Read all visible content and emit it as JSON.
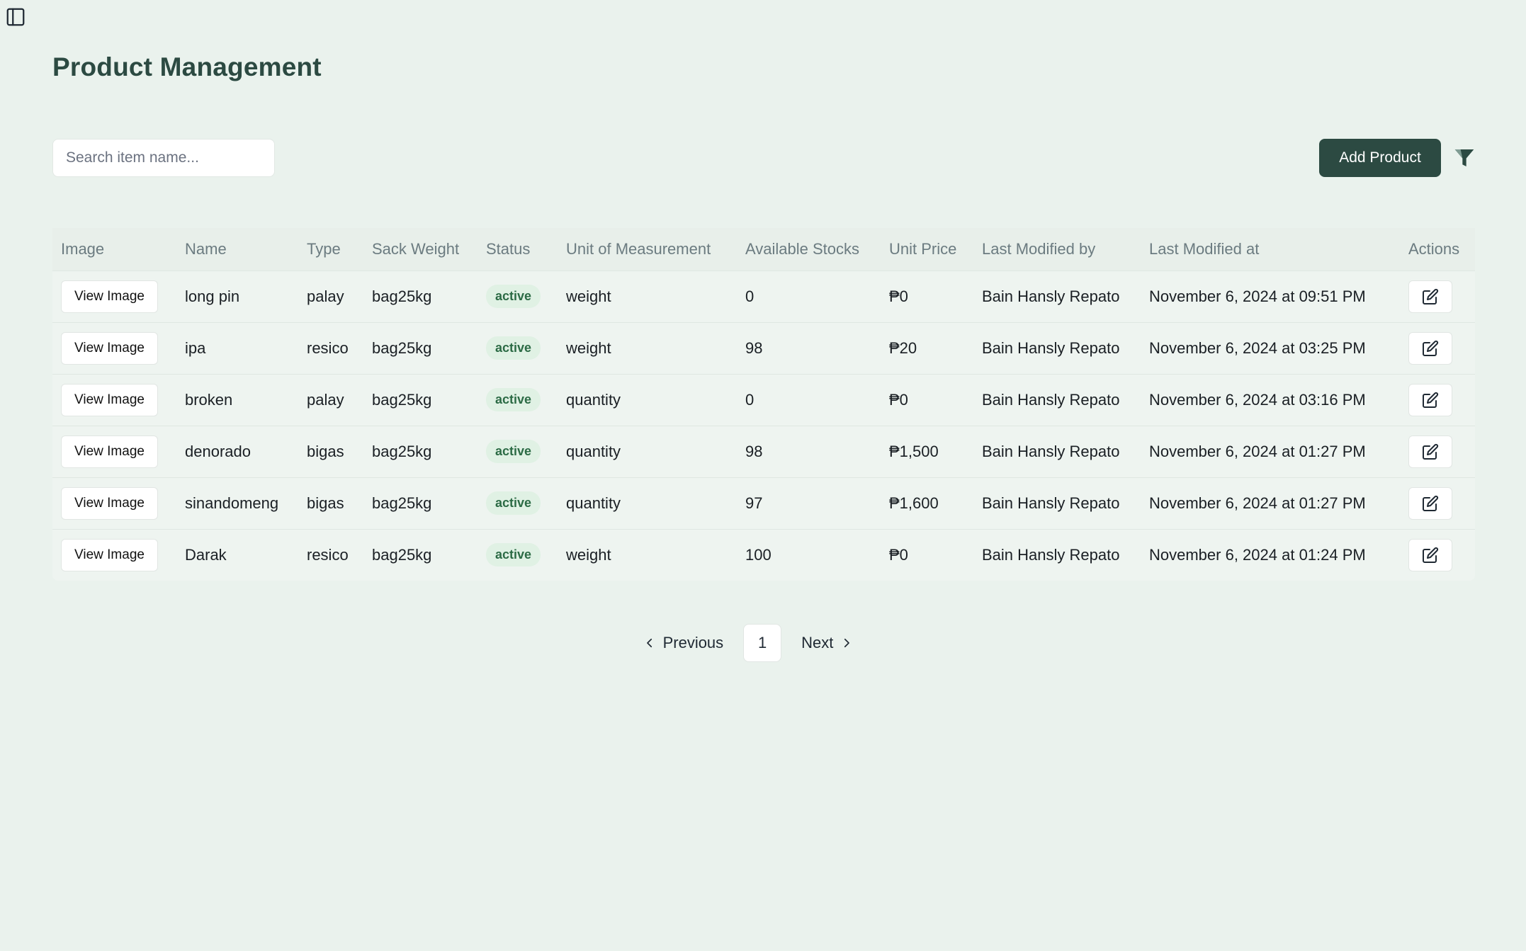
{
  "page": {
    "title": "Product Management"
  },
  "toolbar": {
    "search_placeholder": "Search item name...",
    "search_value": "",
    "add_label": "Add Product"
  },
  "colors": {
    "accent": "#2c4a42",
    "background": "#eaf2ed",
    "status_bg": "#e0f1e4",
    "status_text": "#2c6b45"
  },
  "icons": {
    "sidebar_toggle": "sidebar-toggle-icon",
    "filter": "filter-icon",
    "edit": "edit-icon",
    "prev": "chevron-left-icon",
    "next": "chevron-right-icon"
  },
  "table": {
    "headers": [
      "Image",
      "Name",
      "Type",
      "Sack Weight",
      "Status",
      "Unit of Measurement",
      "Available Stocks",
      "Unit Price",
      "Last Modified by",
      "Last Modified at",
      "Actions"
    ],
    "view_image_label": "View Image",
    "rows": [
      {
        "name": "long pin",
        "type": "palay",
        "sack_weight": "bag25kg",
        "status": "active",
        "unit": "weight",
        "stocks": "0",
        "price": "₱0",
        "modified_by": "Bain Hansly Repato",
        "modified_at": "November 6, 2024 at 09:51 PM"
      },
      {
        "name": "ipa",
        "type": "resico",
        "sack_weight": "bag25kg",
        "status": "active",
        "unit": "weight",
        "stocks": "98",
        "price": "₱20",
        "modified_by": "Bain Hansly Repato",
        "modified_at": "November 6, 2024 at 03:25 PM"
      },
      {
        "name": "broken",
        "type": "palay",
        "sack_weight": "bag25kg",
        "status": "active",
        "unit": "quantity",
        "stocks": "0",
        "price": "₱0",
        "modified_by": "Bain Hansly Repato",
        "modified_at": "November 6, 2024 at 03:16 PM"
      },
      {
        "name": "denorado",
        "type": "bigas",
        "sack_weight": "bag25kg",
        "status": "active",
        "unit": "quantity",
        "stocks": "98",
        "price": "₱1,500",
        "modified_by": "Bain Hansly Repato",
        "modified_at": "November 6, 2024 at 01:27 PM"
      },
      {
        "name": "sinandomeng",
        "type": "bigas",
        "sack_weight": "bag25kg",
        "status": "active",
        "unit": "quantity",
        "stocks": "97",
        "price": "₱1,600",
        "modified_by": "Bain Hansly Repato",
        "modified_at": "November 6, 2024 at 01:27 PM"
      },
      {
        "name": "Darak",
        "type": "resico",
        "sack_weight": "bag25kg",
        "status": "active",
        "unit": "weight",
        "stocks": "100",
        "price": "₱0",
        "modified_by": "Bain Hansly Repato",
        "modified_at": "November 6, 2024 at 01:24 PM"
      }
    ]
  },
  "pagination": {
    "previous_label": "Previous",
    "next_label": "Next",
    "current_page": "1"
  }
}
